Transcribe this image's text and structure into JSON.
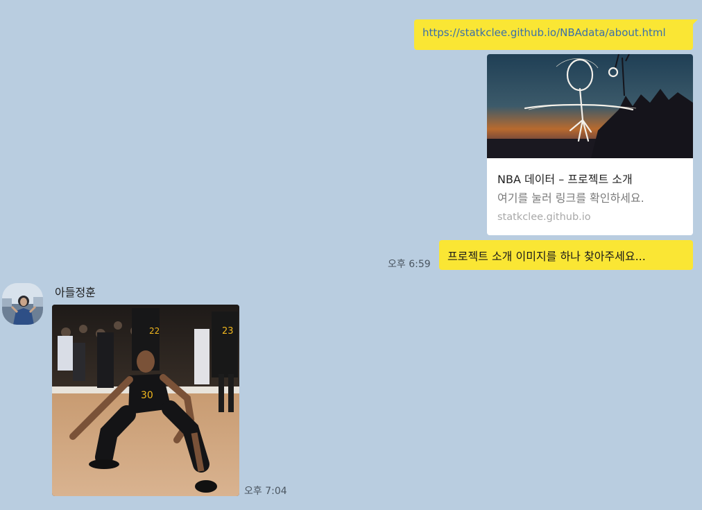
{
  "chat": {
    "my_messages": {
      "url_text": "https://statkclee.github.io/NBAdata/about.html",
      "link_preview": {
        "title": "NBA 데이터 – 프로젝트 소개",
        "description": "여기를 눌러 링크를 확인하세요.",
        "domain": "statkclee.github.io"
      },
      "request_text": "프로젝트 소개 이미지를 하나 찾아주세요...",
      "time": "오후 6:59"
    },
    "other_message": {
      "sender": "아들정훈",
      "time": "오후 7:04"
    }
  },
  "colors": {
    "background": "#b9cde0",
    "my_bubble": "#fae634",
    "link_text": "#3a6fa8",
    "card": "#ffffff"
  }
}
